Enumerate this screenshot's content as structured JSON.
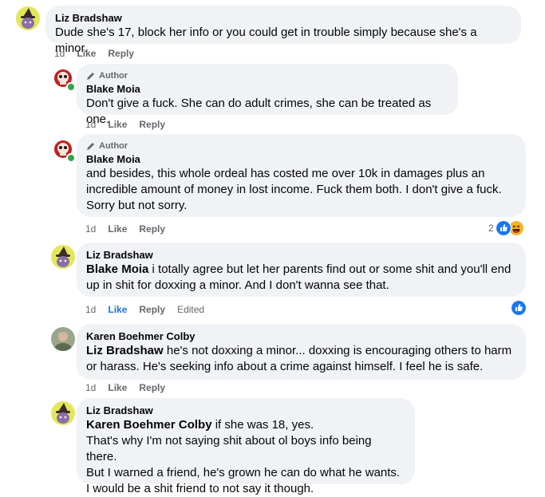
{
  "colors": {
    "bubble": "#f0f2f5",
    "meta_text": "#65676b",
    "like_blue": "#1b74e4",
    "online_green": "#31a24c"
  },
  "labels": {
    "time": "1d",
    "like": "Like",
    "reply": "Reply",
    "edited": "Edited",
    "author_badge": "Author"
  },
  "comments": [
    {
      "name": "Liz Bradshaw",
      "avatar": "witch-cat-avatar",
      "text": "Dude she's 17, block her info or you could get in trouble simply because she's a minor."
    },
    {
      "name": "Blake Moia",
      "avatar": "skull-avatar",
      "text": "Don't give a fuck. She can do adult crimes, she can be treated as one."
    },
    {
      "name": "Blake Moia",
      "avatar": "skull-avatar",
      "lines": [
        "and besides, this whole ordeal has costed me over 10k in damages plus an",
        "incredible amount of money in lost income. Fuck them both. I don't give a fuck.",
        "Sorry but not sorry."
      ],
      "reaction_count": "2"
    },
    {
      "name": "Liz Bradshaw",
      "avatar": "witch-cat-avatar",
      "mention": "Blake Moia",
      "lines": [
        " i totally agree but let her parents find out or some shit and you'll end",
        "up in shit for doxxing a minor. And I don't wanna see that."
      ]
    },
    {
      "name": "Karen Boehmer Colby",
      "avatar": "photo-avatar",
      "mention": "Liz Bradshaw",
      "lines": [
        " he's not doxxing a minor... doxxing is encouraging others to harm",
        "or harass. He's seeking info about a crime against himself. I feel he is safe."
      ]
    },
    {
      "name": "Liz Bradshaw",
      "avatar": "witch-cat-avatar",
      "mention": "Karen Boehmer Colby",
      "lines": [
        " if she was 18, yes.",
        "That's why I'm not saying shit about ol boys info being there.",
        "But I warned a friend, he's grown he can do what he wants.",
        "I would be a shit friend to not say it though."
      ]
    }
  ]
}
